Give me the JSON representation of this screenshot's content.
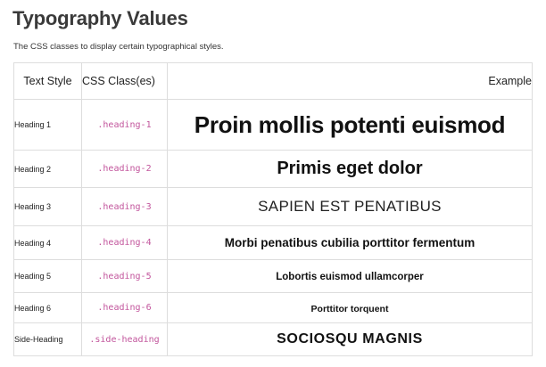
{
  "page": {
    "title": "Typography Values",
    "description": "The CSS classes to display certain typographical styles."
  },
  "table": {
    "headers": {
      "text_style": "Text Style",
      "css_class": "CSS Class(es)",
      "example": "Example"
    },
    "rows": [
      {
        "style": "Heading 1",
        "css_class": ".heading-1",
        "example": "Proin mollis potenti euismod"
      },
      {
        "style": "Heading 2",
        "css_class": ".heading-2",
        "example": "Primis eget dolor"
      },
      {
        "style": "Heading 3",
        "css_class": ".heading-3",
        "example": "SAPIEN EST PENATIBUS"
      },
      {
        "style": "Heading 4",
        "css_class": ".heading-4",
        "example": "Morbi penatibus cubilia porttitor fermentum"
      },
      {
        "style": "Heading 5",
        "css_class": ".heading-5",
        "example": "Lobortis euismod ullamcorper"
      },
      {
        "style": "Heading 6",
        "css_class": ".heading-6",
        "example": "Porttitor torquent"
      },
      {
        "style": "Side-Heading",
        "css_class": ".side-heading",
        "example": "SOCIOSQU MAGNIS"
      }
    ]
  },
  "colors": {
    "class_text": "#c2559c",
    "border": "#dddddd",
    "title": "#3a3a3a"
  }
}
